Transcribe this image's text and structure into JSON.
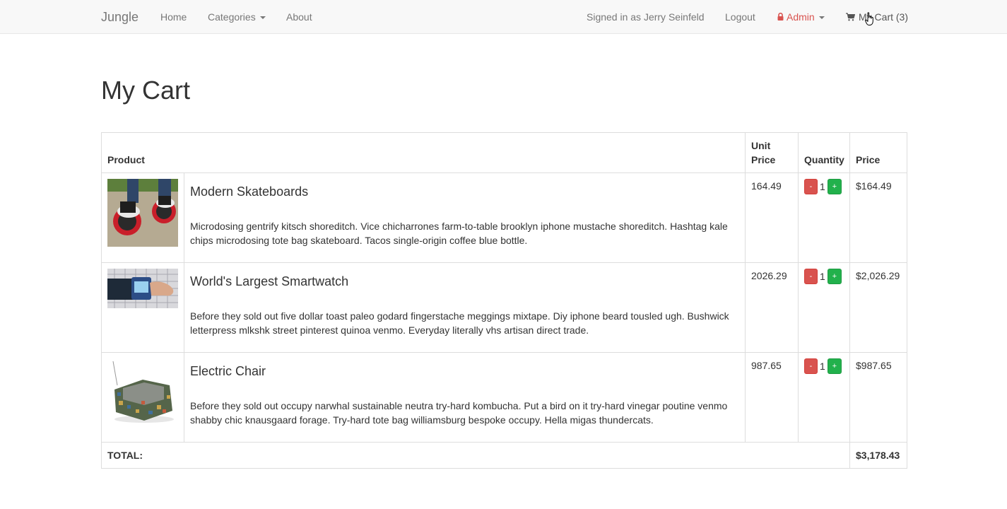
{
  "navbar": {
    "brand": "Jungle",
    "home": "Home",
    "categories": "Categories",
    "about": "About",
    "signed_in": "Signed in as Jerry Seinfeld",
    "logout": "Logout",
    "admin": "Admin",
    "cart": "My Cart (3)"
  },
  "page": {
    "title": "My Cart"
  },
  "table": {
    "headers": {
      "product": "Product",
      "unit_price": "Unit Price",
      "quantity": "Quantity",
      "price": "Price"
    },
    "items": [
      {
        "name": "Modern Skateboards",
        "description": "Microdosing gentrify kitsch shoreditch. Vice chicharrones farm-to-table brooklyn iphone mustache shoreditch. Hashtag kale chips microdosing tote bag skateboard. Tacos single-origin coffee blue bottle.",
        "unit_price": "164.49",
        "quantity": "1",
        "price": "$164.49",
        "minus": "-",
        "plus": "+"
      },
      {
        "name": "World's Largest Smartwatch",
        "description": "Before they sold out five dollar toast paleo godard fingerstache meggings mixtape. Diy iphone beard tousled ugh. Bushwick letterpress mlkshk street pinterest quinoa venmo. Everyday literally vhs artisan direct trade.",
        "unit_price": "2026.29",
        "quantity": "1",
        "price": "$2,026.29",
        "minus": "-",
        "plus": "+"
      },
      {
        "name": "Electric Chair",
        "description": "Before they sold out occupy narwhal sustainable neutra try-hard kombucha. Put a bird on it try-hard vinegar poutine venmo shabby chic knausgaard forage. Try-hard tote bag williamsburg bespoke occupy. Hella migas thundercats.",
        "unit_price": "987.65",
        "quantity": "1",
        "price": "$987.65",
        "minus": "-",
        "plus": "+"
      }
    ],
    "total_label": "TOTAL:",
    "total_value": "$3,178.43"
  },
  "colors": {
    "admin": "#d9534f",
    "minus": "#d9534f",
    "plus": "#22b14c"
  },
  "icons": [
    "caret-down-icon",
    "lock-icon",
    "cart-icon",
    "pointer-cursor-icon"
  ]
}
